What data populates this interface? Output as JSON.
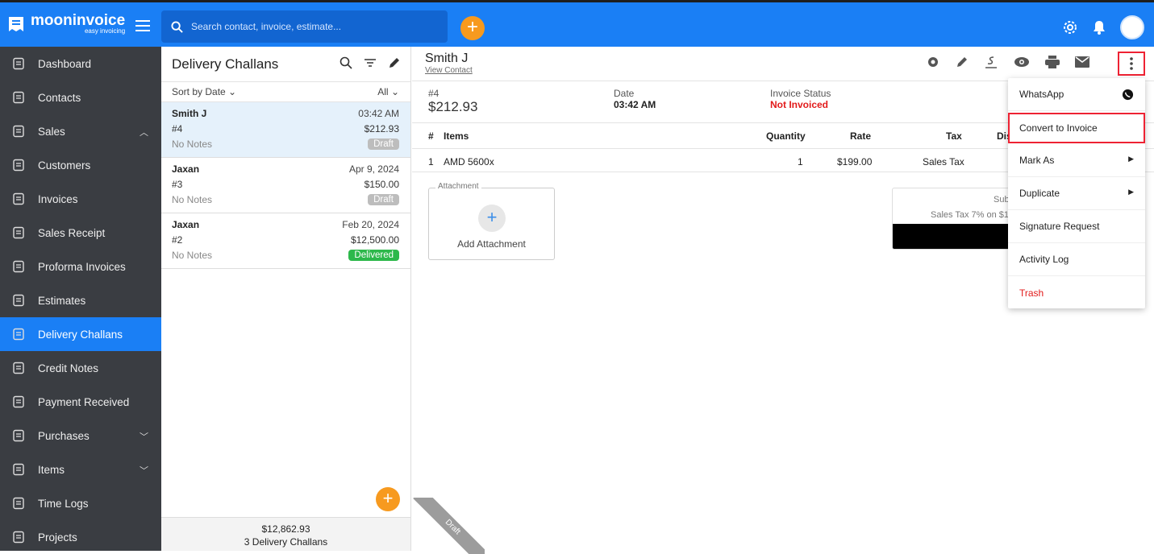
{
  "app": {
    "brand": "mooninvoice",
    "tagline": "easy invoicing"
  },
  "search": {
    "placeholder": "Search contact, invoice, estimate..."
  },
  "sidebar": {
    "items": [
      {
        "label": "Dashboard",
        "icon": "home-icon"
      },
      {
        "label": "Contacts",
        "icon": "contacts-icon"
      },
      {
        "label": "Sales",
        "icon": "sales-icon",
        "chevron": "up"
      },
      {
        "label": "Customers",
        "icon": "customers-icon"
      },
      {
        "label": "Invoices",
        "icon": "invoices-icon"
      },
      {
        "label": "Sales Receipt",
        "icon": "receipt-icon"
      },
      {
        "label": "Proforma Invoices",
        "icon": "proforma-icon"
      },
      {
        "label": "Estimates",
        "icon": "estimates-icon"
      },
      {
        "label": "Delivery Challans",
        "icon": "delivery-icon",
        "active": true
      },
      {
        "label": "Credit Notes",
        "icon": "credit-note-icon"
      },
      {
        "label": "Payment Received",
        "icon": "payment-icon"
      },
      {
        "label": "Purchases",
        "icon": "purchases-icon",
        "chevron": "down"
      },
      {
        "label": "Items",
        "icon": "items-icon",
        "chevron": "down"
      },
      {
        "label": "Time Logs",
        "icon": "clock-icon"
      },
      {
        "label": "Projects",
        "icon": "folder-icon"
      }
    ]
  },
  "list": {
    "title": "Delivery Challans",
    "sort_label": "Sort by Date",
    "filter_label": "All",
    "rows": [
      {
        "name": "Smith J",
        "time": "03:42 AM",
        "number": "#4",
        "amount": "$212.93",
        "notes": "No Notes",
        "status": "Draft"
      },
      {
        "name": "Jaxan",
        "time": "Apr 9, 2024",
        "number": "#3",
        "amount": "$150.00",
        "notes": "No Notes",
        "status": "Draft"
      },
      {
        "name": "Jaxan",
        "time": "Feb 20, 2024",
        "number": "#2",
        "amount": "$12,500.00",
        "notes": "No Notes",
        "status": "Delivered"
      }
    ],
    "footer_total": "$12,862.93",
    "footer_count": "3 Delivery Challans"
  },
  "detail": {
    "contact_name": "Smith J",
    "view_contact": "View Contact",
    "number": "#4",
    "amount": "$212.93",
    "date_label": "Date",
    "date_value": "03:42 AM",
    "status_label": "Invoice Status",
    "status_value": "Not Invoiced",
    "columns": {
      "hash": "#",
      "items": "Items",
      "quantity": "Quantity",
      "rate": "Rate",
      "tax": "Tax",
      "dis": "Dis"
    },
    "line": {
      "no": "1",
      "item": "AMD 5600x",
      "qty": "1",
      "rate": "$199.00",
      "tax": "Sales Tax"
    },
    "attachment_legend": "Attachment",
    "attachment_label": "Add Attachment",
    "totals_sub": "Sub",
    "totals_tax": "Sales Tax 7% on $1",
    "ribbon": "Draft"
  },
  "menu": {
    "whatsapp": "WhatsApp",
    "convert": "Convert to Invoice",
    "mark_as": "Mark As",
    "duplicate": "Duplicate",
    "signature": "Signature Request",
    "activity": "Activity Log",
    "trash": "Trash"
  },
  "colors": {
    "brand": "#1a7ff5",
    "accent": "#f79a1f",
    "sidebar": "#3a3d42",
    "danger": "#e21a1a",
    "delivered": "#2db84b"
  }
}
